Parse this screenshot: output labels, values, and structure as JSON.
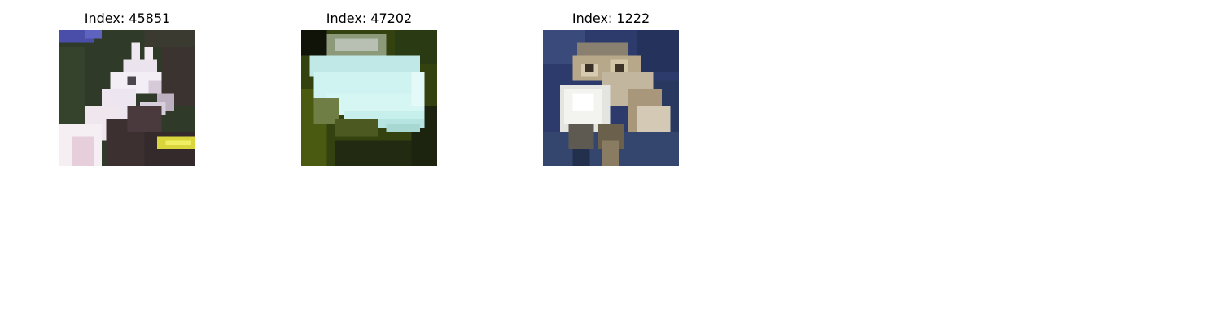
{
  "figure": {
    "panels": [
      {
        "title": "Index: 45851",
        "image_icon": "horse-head-photo-icon",
        "dominant_colors": [
          "#2e3a26",
          "#e9e0ea",
          "#3a2f30",
          "#d8d43a"
        ]
      },
      {
        "title": "Index: 47202",
        "image_icon": "boat-photo-icon",
        "dominant_colors": [
          "#2a3a10",
          "#c9f0ee",
          "#5a6a1a",
          "#1a1a10"
        ]
      },
      {
        "title": "Index: 1222",
        "image_icon": "frog-photo-icon",
        "dominant_colors": [
          "#2b3a6a",
          "#e6e6e0",
          "#b8a890",
          "#1e2a4a"
        ]
      }
    ]
  }
}
